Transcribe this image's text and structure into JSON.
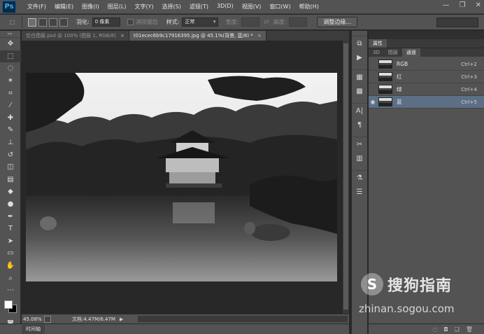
{
  "app": {
    "logo": "Ps"
  },
  "menu": [
    "文件(F)",
    "编辑(E)",
    "图像(I)",
    "图层(L)",
    "文字(Y)",
    "选择(S)",
    "滤镜(T)",
    "3D(D)",
    "视图(V)",
    "窗口(W)",
    "帮助(H)"
  ],
  "window_controls": {
    "minimize": "—",
    "restore": "❐",
    "close": "✕"
  },
  "options": {
    "feather_label": "羽化:",
    "feather_value": "0 像素",
    "antialias_label": "消除锯齿",
    "style_label": "样式:",
    "style_value": "正常",
    "width_label": "宽度:",
    "height_label": "高度:",
    "refine_edge": "调整边缘..."
  },
  "tabs": [
    {
      "label": "空白图层.psd @ 100% (图层 1, RGB/8)",
      "active": false
    },
    {
      "label": "t01ecec6b9c17916395.jpg @ 45.1%(背景, 蓝/8) *",
      "active": true
    }
  ],
  "tab_close": "×",
  "status": {
    "zoom": "45.08%",
    "doc_info": "文档:4.47M/6.47M",
    "arrow": "▶"
  },
  "timeline": {
    "label": "时间轴"
  },
  "right_panel": {
    "header_tab": "属性",
    "sub_tabs": [
      "3D",
      "图层",
      "通道"
    ],
    "active_sub_tab": "通道",
    "channels": [
      {
        "name": "RGB",
        "shortcut": "Ctrl+2",
        "visible": false,
        "selected": false
      },
      {
        "name": "红",
        "shortcut": "Ctrl+3",
        "visible": false,
        "selected": false
      },
      {
        "name": "绿",
        "shortcut": "Ctrl+4",
        "visible": false,
        "selected": false
      },
      {
        "name": "蓝",
        "shortcut": "Ctrl+5",
        "visible": true,
        "selected": true
      }
    ]
  },
  "watermark": {
    "logo_letter": "S",
    "title": "搜狗指南",
    "url": "zhinan.sogou.com"
  },
  "colors": {
    "accent_selected_row": "#5c6f85",
    "ps_logo_blue": "#3fa9f5"
  }
}
